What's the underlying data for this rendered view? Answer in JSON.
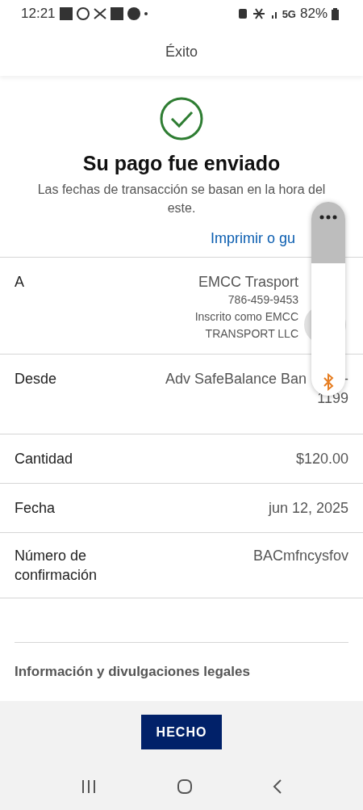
{
  "status_bar": {
    "time": "12:21",
    "battery": "82%",
    "network": "5G"
  },
  "header": {
    "title": "Éxito"
  },
  "result": {
    "title": "Su pago fue enviado",
    "note": "Las fechas de transacción se basan en la hora del este.",
    "link": "Imprimir o gu"
  },
  "details": [
    {
      "label": "A",
      "lines": [
        "EMCC Trasport",
        "786-459-9453",
        "Inscrito como EMCC",
        "TRANSPORT LLC"
      ]
    },
    {
      "label": "Desde",
      "lines": [
        "Adv SafeBalance Ban",
        "-",
        "1199"
      ]
    },
    {
      "label": "Cantidad",
      "lines": [
        "$120.00"
      ]
    },
    {
      "label": "Fecha",
      "lines": [
        "jun 12, 2025"
      ]
    },
    {
      "label": "Número de confirmación",
      "lines": [
        "BACmfncysfov"
      ]
    }
  ],
  "legal": "Información y divulgaciones legales",
  "button": "HECHO"
}
